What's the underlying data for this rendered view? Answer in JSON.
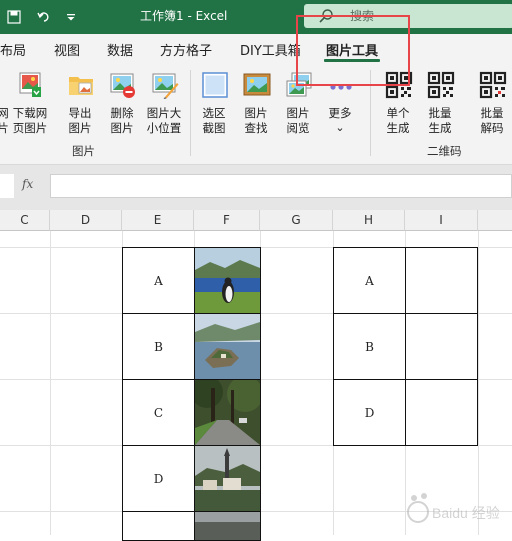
{
  "window": {
    "title": "工作簿1  -  Excel",
    "search_placeholder": "搜索"
  },
  "tabs": [
    {
      "label": "布局"
    },
    {
      "label": "视图"
    },
    {
      "label": "数据"
    },
    {
      "label": "方方格子"
    },
    {
      "label": "DIY工具箱"
    },
    {
      "label": "图片工具",
      "active": true
    }
  ],
  "ribbon": {
    "partial_left": "网\n片",
    "buttons": [
      {
        "label": "下载网\n页图片",
        "icon": "download-web-image-icon"
      },
      {
        "label": "导出\n图片",
        "icon": "export-image-icon"
      },
      {
        "label": "删除\n图片",
        "icon": "delete-image-icon"
      },
      {
        "label": "图片大\n小位置",
        "icon": "image-size-position-icon"
      },
      {
        "label": "选区\n截图",
        "icon": "selection-screenshot-icon"
      },
      {
        "label": "图片\n查找",
        "icon": "image-find-icon"
      },
      {
        "label": "图片\n阅览",
        "icon": "image-preview-icon"
      },
      {
        "label": "更多",
        "icon": "more-dots-icon"
      },
      {
        "label": "单个\n生成",
        "icon": "qr-single-icon"
      },
      {
        "label": "批量\n生成",
        "icon": "qr-batch-icon"
      },
      {
        "label": "批量\n解码",
        "icon": "qr-decode-icon"
      }
    ],
    "more_chevron": "⌄",
    "group_images": "图片",
    "group_qrcode": "二维码"
  },
  "formula_bar": {
    "fx": "fx",
    "value": ""
  },
  "columns": [
    "C",
    "D",
    "E",
    "F",
    "G",
    "H",
    "I"
  ],
  "table_left": {
    "labels": [
      "A",
      "B",
      "C",
      "D",
      ""
    ],
    "photos": [
      "penguin-photo",
      "island-photo",
      "tree-road-photo",
      "village-photo",
      "partial-photo"
    ]
  },
  "table_right": {
    "labels": [
      "A",
      "B",
      "D"
    ]
  },
  "watermark": "Baidu 经验",
  "colors": {
    "excel_green": "#217346",
    "highlight_red": "#e8454a",
    "ribbon_bg": "#f3f3f3"
  }
}
